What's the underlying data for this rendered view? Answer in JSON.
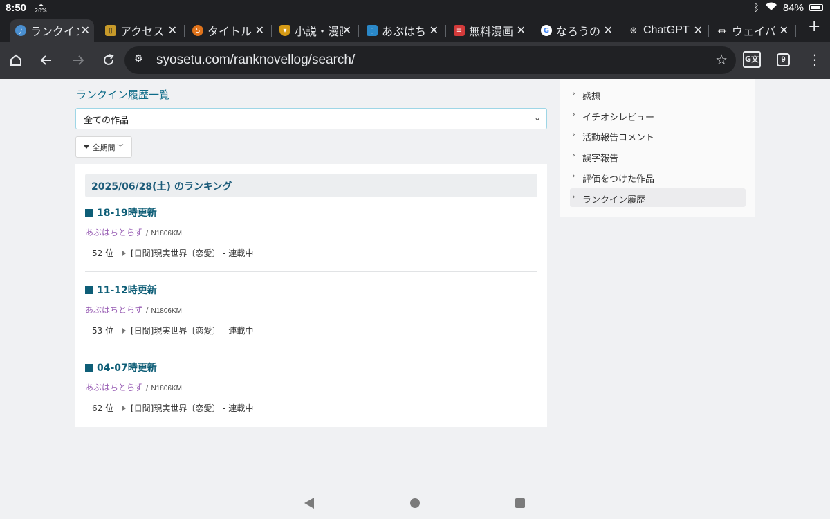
{
  "statusbar": {
    "time": "8:50",
    "indicator": "20%",
    "battery": "84%"
  },
  "tabs": [
    {
      "title": "ランクイン",
      "active": true,
      "favicon_color": "#4a8fd0"
    },
    {
      "title": "アクセス",
      "active": false,
      "favicon_color": "#c79a2a"
    },
    {
      "title": "タイトル",
      "active": false,
      "favicon_color": "#e0731b"
    },
    {
      "title": "小説・漫画",
      "active": false,
      "favicon_color": "#d59a15"
    },
    {
      "title": "あぶはち",
      "active": false,
      "favicon_color": "#2a88c8"
    },
    {
      "title": "無料漫画",
      "active": false,
      "favicon_color": "#d33a3a"
    },
    {
      "title": "なろうの",
      "active": false,
      "favicon_color": "#ffffff"
    },
    {
      "title": "ChatGPT",
      "active": false,
      "favicon_color": "#35363a"
    },
    {
      "title": "ウェイバ",
      "active": false,
      "favicon_color": "#35363a"
    }
  ],
  "toolbar": {
    "url": "syosetu.com/ranknovellog/search/",
    "tab_count": "9",
    "translate_label": "G文"
  },
  "page": {
    "history_link": "ランクイン履歴一覧",
    "select_value": "全ての作品",
    "period_label": "全期間",
    "date_heading": "2025/06/28(土) のランキング",
    "entries": [
      {
        "update": "18-19時更新",
        "author": "あぶはちとらず",
        "separator": "/",
        "ncode": "N1806KM",
        "rank": "52 位",
        "genre": "[日間]現実世界〔恋愛〕 - 連載中"
      },
      {
        "update": "11-12時更新",
        "author": "あぶはちとらず",
        "separator": "/",
        "ncode": "N1806KM",
        "rank": "53 位",
        "genre": "[日間]現実世界〔恋愛〕 - 連載中"
      },
      {
        "update": "04-07時更新",
        "author": "あぶはちとらず",
        "separator": "/",
        "ncode": "N1806KM",
        "rank": "62 位",
        "genre": "[日間]現実世界〔恋愛〕 - 連載中"
      }
    ]
  },
  "sidebar": {
    "items": [
      {
        "label": "感想",
        "active": false
      },
      {
        "label": "イチオシレビュー",
        "active": false
      },
      {
        "label": "活動報告コメント",
        "active": false
      },
      {
        "label": "誤字報告",
        "active": false
      },
      {
        "label": "評価をつけた作品",
        "active": false
      },
      {
        "label": "ランクイン履歴",
        "active": true
      }
    ]
  },
  "colors": {
    "accent": "#0e5e77",
    "author": "#9b62b6",
    "tab_active": "#35363a"
  }
}
